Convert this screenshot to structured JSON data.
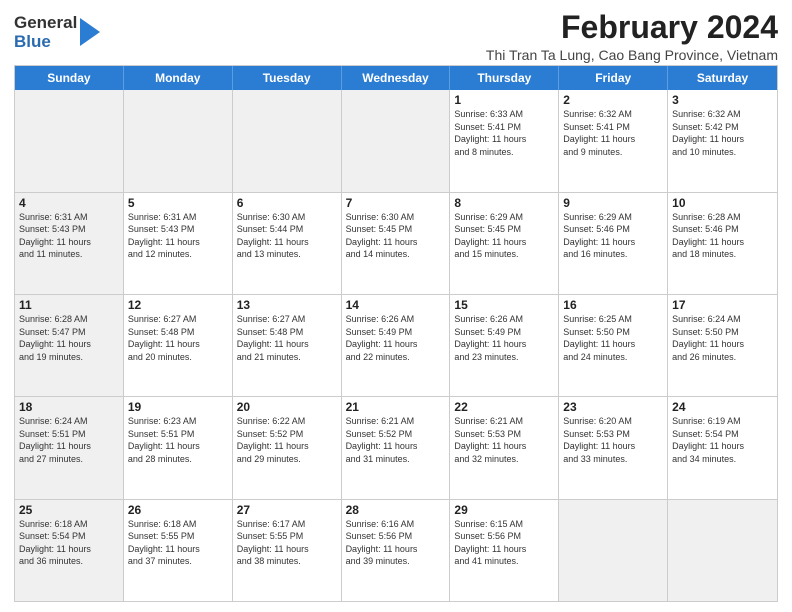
{
  "logo": {
    "general": "General",
    "blue": "Blue"
  },
  "title": "February 2024",
  "subtitle": "Thi Tran Ta Lung, Cao Bang Province, Vietnam",
  "headers": [
    "Sunday",
    "Monday",
    "Tuesday",
    "Wednesday",
    "Thursday",
    "Friday",
    "Saturday"
  ],
  "weeks": [
    [
      {
        "day": "",
        "info": "",
        "shaded": true
      },
      {
        "day": "",
        "info": "",
        "shaded": true
      },
      {
        "day": "",
        "info": "",
        "shaded": true
      },
      {
        "day": "",
        "info": "",
        "shaded": true
      },
      {
        "day": "1",
        "info": "Sunrise: 6:33 AM\nSunset: 5:41 PM\nDaylight: 11 hours\nand 8 minutes."
      },
      {
        "day": "2",
        "info": "Sunrise: 6:32 AM\nSunset: 5:41 PM\nDaylight: 11 hours\nand 9 minutes."
      },
      {
        "day": "3",
        "info": "Sunrise: 6:32 AM\nSunset: 5:42 PM\nDaylight: 11 hours\nand 10 minutes."
      }
    ],
    [
      {
        "day": "4",
        "info": "Sunrise: 6:31 AM\nSunset: 5:43 PM\nDaylight: 11 hours\nand 11 minutes.",
        "shaded": true
      },
      {
        "day": "5",
        "info": "Sunrise: 6:31 AM\nSunset: 5:43 PM\nDaylight: 11 hours\nand 12 minutes."
      },
      {
        "day": "6",
        "info": "Sunrise: 6:30 AM\nSunset: 5:44 PM\nDaylight: 11 hours\nand 13 minutes."
      },
      {
        "day": "7",
        "info": "Sunrise: 6:30 AM\nSunset: 5:45 PM\nDaylight: 11 hours\nand 14 minutes."
      },
      {
        "day": "8",
        "info": "Sunrise: 6:29 AM\nSunset: 5:45 PM\nDaylight: 11 hours\nand 15 minutes."
      },
      {
        "day": "9",
        "info": "Sunrise: 6:29 AM\nSunset: 5:46 PM\nDaylight: 11 hours\nand 16 minutes."
      },
      {
        "day": "10",
        "info": "Sunrise: 6:28 AM\nSunset: 5:46 PM\nDaylight: 11 hours\nand 18 minutes."
      }
    ],
    [
      {
        "day": "11",
        "info": "Sunrise: 6:28 AM\nSunset: 5:47 PM\nDaylight: 11 hours\nand 19 minutes.",
        "shaded": true
      },
      {
        "day": "12",
        "info": "Sunrise: 6:27 AM\nSunset: 5:48 PM\nDaylight: 11 hours\nand 20 minutes."
      },
      {
        "day": "13",
        "info": "Sunrise: 6:27 AM\nSunset: 5:48 PM\nDaylight: 11 hours\nand 21 minutes."
      },
      {
        "day": "14",
        "info": "Sunrise: 6:26 AM\nSunset: 5:49 PM\nDaylight: 11 hours\nand 22 minutes."
      },
      {
        "day": "15",
        "info": "Sunrise: 6:26 AM\nSunset: 5:49 PM\nDaylight: 11 hours\nand 23 minutes."
      },
      {
        "day": "16",
        "info": "Sunrise: 6:25 AM\nSunset: 5:50 PM\nDaylight: 11 hours\nand 24 minutes."
      },
      {
        "day": "17",
        "info": "Sunrise: 6:24 AM\nSunset: 5:50 PM\nDaylight: 11 hours\nand 26 minutes."
      }
    ],
    [
      {
        "day": "18",
        "info": "Sunrise: 6:24 AM\nSunset: 5:51 PM\nDaylight: 11 hours\nand 27 minutes.",
        "shaded": true
      },
      {
        "day": "19",
        "info": "Sunrise: 6:23 AM\nSunset: 5:51 PM\nDaylight: 11 hours\nand 28 minutes."
      },
      {
        "day": "20",
        "info": "Sunrise: 6:22 AM\nSunset: 5:52 PM\nDaylight: 11 hours\nand 29 minutes."
      },
      {
        "day": "21",
        "info": "Sunrise: 6:21 AM\nSunset: 5:52 PM\nDaylight: 11 hours\nand 31 minutes."
      },
      {
        "day": "22",
        "info": "Sunrise: 6:21 AM\nSunset: 5:53 PM\nDaylight: 11 hours\nand 32 minutes."
      },
      {
        "day": "23",
        "info": "Sunrise: 6:20 AM\nSunset: 5:53 PM\nDaylight: 11 hours\nand 33 minutes."
      },
      {
        "day": "24",
        "info": "Sunrise: 6:19 AM\nSunset: 5:54 PM\nDaylight: 11 hours\nand 34 minutes."
      }
    ],
    [
      {
        "day": "25",
        "info": "Sunrise: 6:18 AM\nSunset: 5:54 PM\nDaylight: 11 hours\nand 36 minutes.",
        "shaded": true
      },
      {
        "day": "26",
        "info": "Sunrise: 6:18 AM\nSunset: 5:55 PM\nDaylight: 11 hours\nand 37 minutes."
      },
      {
        "day": "27",
        "info": "Sunrise: 6:17 AM\nSunset: 5:55 PM\nDaylight: 11 hours\nand 38 minutes."
      },
      {
        "day": "28",
        "info": "Sunrise: 6:16 AM\nSunset: 5:56 PM\nDaylight: 11 hours\nand 39 minutes."
      },
      {
        "day": "29",
        "info": "Sunrise: 6:15 AM\nSunset: 5:56 PM\nDaylight: 11 hours\nand 41 minutes."
      },
      {
        "day": "",
        "info": "",
        "shaded": true
      },
      {
        "day": "",
        "info": "",
        "shaded": true
      }
    ]
  ]
}
